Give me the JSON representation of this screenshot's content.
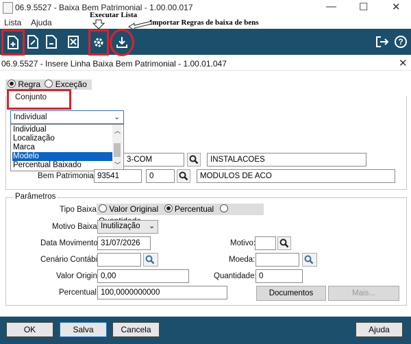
{
  "window": {
    "title": "06.9.5527 - Baixa Bem Patrimonial - 1.00.00.017",
    "minimize": "—",
    "maximize": "☐",
    "close": "✕"
  },
  "menu": {
    "items": [
      "Lista",
      "Ajuda"
    ]
  },
  "annotations": {
    "executar": "Executar Lista",
    "importar": "Importar Regras de baixa de bens"
  },
  "toolbar": {
    "icons": [
      "new-record-icon",
      "edit-icon",
      "copy-icon",
      "delete-icon",
      "settings-icon",
      "download-icon",
      "exit-icon",
      "help-icon"
    ],
    "accent": "#1c4f6b",
    "highlight": "#e0202a"
  },
  "dialog": {
    "title": "06.9.5527 - Insere Linha Baixa Bem Patrimonial - 1.00.01.047",
    "close": "✕",
    "mode": {
      "regra": "Regra",
      "excecao": "Exceção",
      "selected": "Regra"
    },
    "conjunto": {
      "label": "Conjunto",
      "value": "Individual",
      "options": [
        "Individual",
        "Localização",
        "Marca",
        "Modelo",
        "Percentual Baixado"
      ],
      "selected": "Modelo",
      "partial_code": "3-COM",
      "desc1": "INSTALACOES",
      "bem_label": "Bem Patrimonial:",
      "bem_value": "93541",
      "bem_seq": "0",
      "desc2": "MODULOS DE ACO"
    },
    "parametros": {
      "legend": "Parâmetros",
      "tipo_label": "Tipo Baixa:",
      "tipo_options": [
        "Valor Original",
        "Percentual",
        "Quantidade"
      ],
      "tipo_selected": "Percentual",
      "motivo_baixa_label": "Motivo Baixa:",
      "motivo_baixa_value": "Inutilização",
      "data_label": "Data Movimento:",
      "data_value": "31/07/2026",
      "motivo_label": "Motivo:",
      "motivo_value": "",
      "cenario_label": "Cenário Contábil:",
      "cenario_value": "",
      "moeda_label": "Moeda:",
      "moeda_value": "",
      "valor_label": "Valor Origin:",
      "valor_value": "0,00",
      "quantidade_label": "Quantidade:",
      "quantidade_value": "0",
      "percentual_label": "Percentual:",
      "percentual_value": "100,0000000000",
      "documentos_btn": "Documentos",
      "mais_btn": "Mais..."
    },
    "footer": {
      "ok": "OK",
      "salva": "Salva",
      "cancela": "Cancela",
      "ajuda": "Ajuda"
    }
  }
}
